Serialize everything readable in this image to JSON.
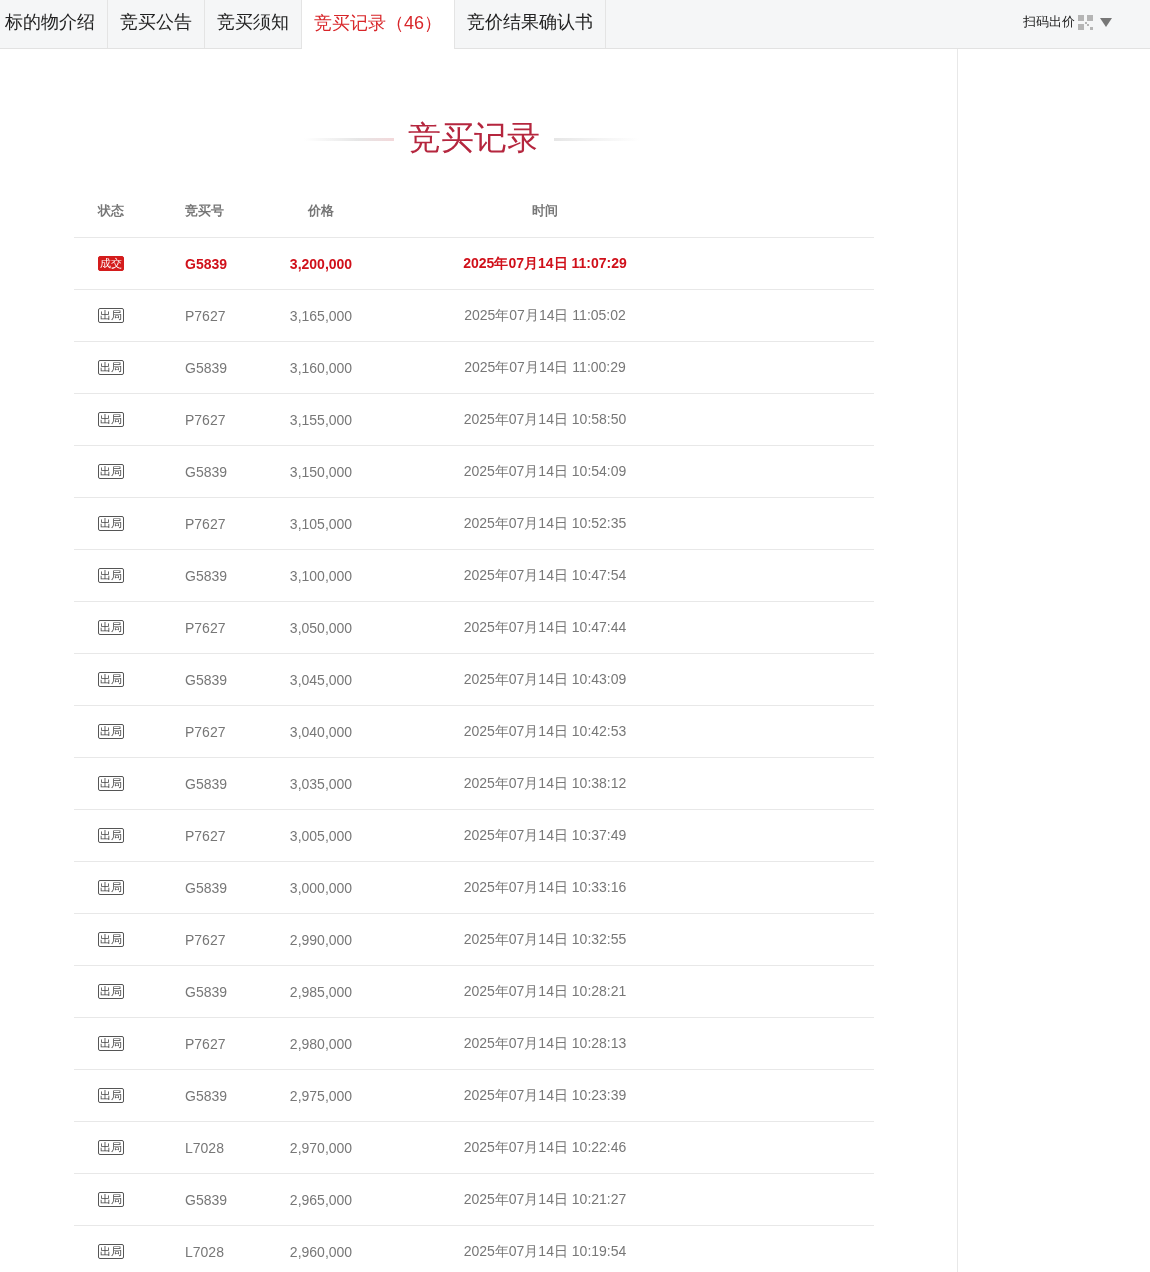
{
  "tabs": [
    {
      "label": "标的物介绍",
      "selected": false
    },
    {
      "label": "竞买公告",
      "selected": false
    },
    {
      "label": "竞买须知",
      "selected": false
    },
    {
      "label": "竞买记录",
      "count": "（46）",
      "selected": true
    },
    {
      "label": "竞价结果确认书",
      "selected": false
    }
  ],
  "scan_bid": {
    "label": "扫码出价"
  },
  "section_title": "竞买记录",
  "table": {
    "columns": [
      "状态",
      "竞买号",
      "价格",
      "时间"
    ],
    "rows": [
      {
        "status": "成交",
        "kind": "deal",
        "bidder": "G5839",
        "price": "3,200,000",
        "time": "2025年07月14日 11:07:29"
      },
      {
        "status": "出局",
        "kind": "out",
        "bidder": "P7627",
        "price": "3,165,000",
        "time": "2025年07月14日 11:05:02"
      },
      {
        "status": "出局",
        "kind": "out",
        "bidder": "G5839",
        "price": "3,160,000",
        "time": "2025年07月14日 11:00:29"
      },
      {
        "status": "出局",
        "kind": "out",
        "bidder": "P7627",
        "price": "3,155,000",
        "time": "2025年07月14日 10:58:50"
      },
      {
        "status": "出局",
        "kind": "out",
        "bidder": "G5839",
        "price": "3,150,000",
        "time": "2025年07月14日 10:54:09"
      },
      {
        "status": "出局",
        "kind": "out",
        "bidder": "P7627",
        "price": "3,105,000",
        "time": "2025年07月14日 10:52:35"
      },
      {
        "status": "出局",
        "kind": "out",
        "bidder": "G5839",
        "price": "3,100,000",
        "time": "2025年07月14日 10:47:54"
      },
      {
        "status": "出局",
        "kind": "out",
        "bidder": "P7627",
        "price": "3,050,000",
        "time": "2025年07月14日 10:47:44"
      },
      {
        "status": "出局",
        "kind": "out",
        "bidder": "G5839",
        "price": "3,045,000",
        "time": "2025年07月14日 10:43:09"
      },
      {
        "status": "出局",
        "kind": "out",
        "bidder": "P7627",
        "price": "3,040,000",
        "time": "2025年07月14日 10:42:53"
      },
      {
        "status": "出局",
        "kind": "out",
        "bidder": "G5839",
        "price": "3,035,000",
        "time": "2025年07月14日 10:38:12"
      },
      {
        "status": "出局",
        "kind": "out",
        "bidder": "P7627",
        "price": "3,005,000",
        "time": "2025年07月14日 10:37:49"
      },
      {
        "status": "出局",
        "kind": "out",
        "bidder": "G5839",
        "price": "3,000,000",
        "time": "2025年07月14日 10:33:16"
      },
      {
        "status": "出局",
        "kind": "out",
        "bidder": "P7627",
        "price": "2,990,000",
        "time": "2025年07月14日 10:32:55"
      },
      {
        "status": "出局",
        "kind": "out",
        "bidder": "G5839",
        "price": "2,985,000",
        "time": "2025年07月14日 10:28:21"
      },
      {
        "status": "出局",
        "kind": "out",
        "bidder": "P7627",
        "price": "2,980,000",
        "time": "2025年07月14日 10:28:13"
      },
      {
        "status": "出局",
        "kind": "out",
        "bidder": "G5839",
        "price": "2,975,000",
        "time": "2025年07月14日 10:23:39"
      },
      {
        "status": "出局",
        "kind": "out",
        "bidder": "L7028",
        "price": "2,970,000",
        "time": "2025年07月14日 10:22:46"
      },
      {
        "status": "出局",
        "kind": "out",
        "bidder": "G5839",
        "price": "2,965,000",
        "time": "2025年07月14日 10:21:27"
      },
      {
        "status": "出局",
        "kind": "out",
        "bidder": "L7028",
        "price": "2,960,000",
        "time": "2025年07月14日 10:19:54"
      }
    ]
  }
}
